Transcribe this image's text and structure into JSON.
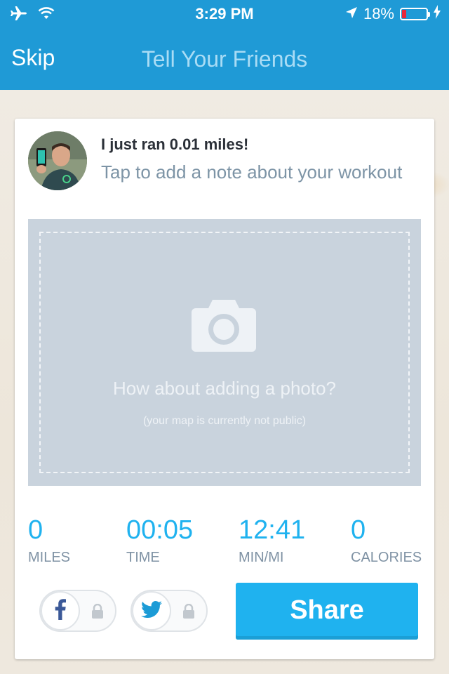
{
  "status": {
    "time": "3:29 PM",
    "battery": "18%",
    "battery_level": 0.18
  },
  "nav": {
    "skip": "Skip",
    "title": "Tell Your Friends"
  },
  "post": {
    "title": "I just ran 0.01 miles!",
    "note_placeholder": "Tap to add a note about your workout"
  },
  "photo": {
    "prompt": "How about adding a photo?",
    "sub": "(your map is currently not public)"
  },
  "stats": [
    {
      "value": "0",
      "label": "MILES"
    },
    {
      "value": "00:05",
      "label": "TIME"
    },
    {
      "value": "12:41",
      "label": "MIN/MI"
    },
    {
      "value": "0",
      "label": "CALORIES"
    }
  ],
  "share": {
    "button": "Share",
    "facebook_enabled": false,
    "twitter_enabled": false
  },
  "icons": [
    "airplane-icon",
    "wifi-icon",
    "location-arrow-icon",
    "battery-icon",
    "charging-icon",
    "camera-icon",
    "facebook-icon",
    "twitter-icon",
    "lock-icon"
  ],
  "colors": {
    "header": "#1f9ad6",
    "accent": "#1fb2ef",
    "photo_bg": "#c9d3dd",
    "battery_low": "#e8263a"
  }
}
